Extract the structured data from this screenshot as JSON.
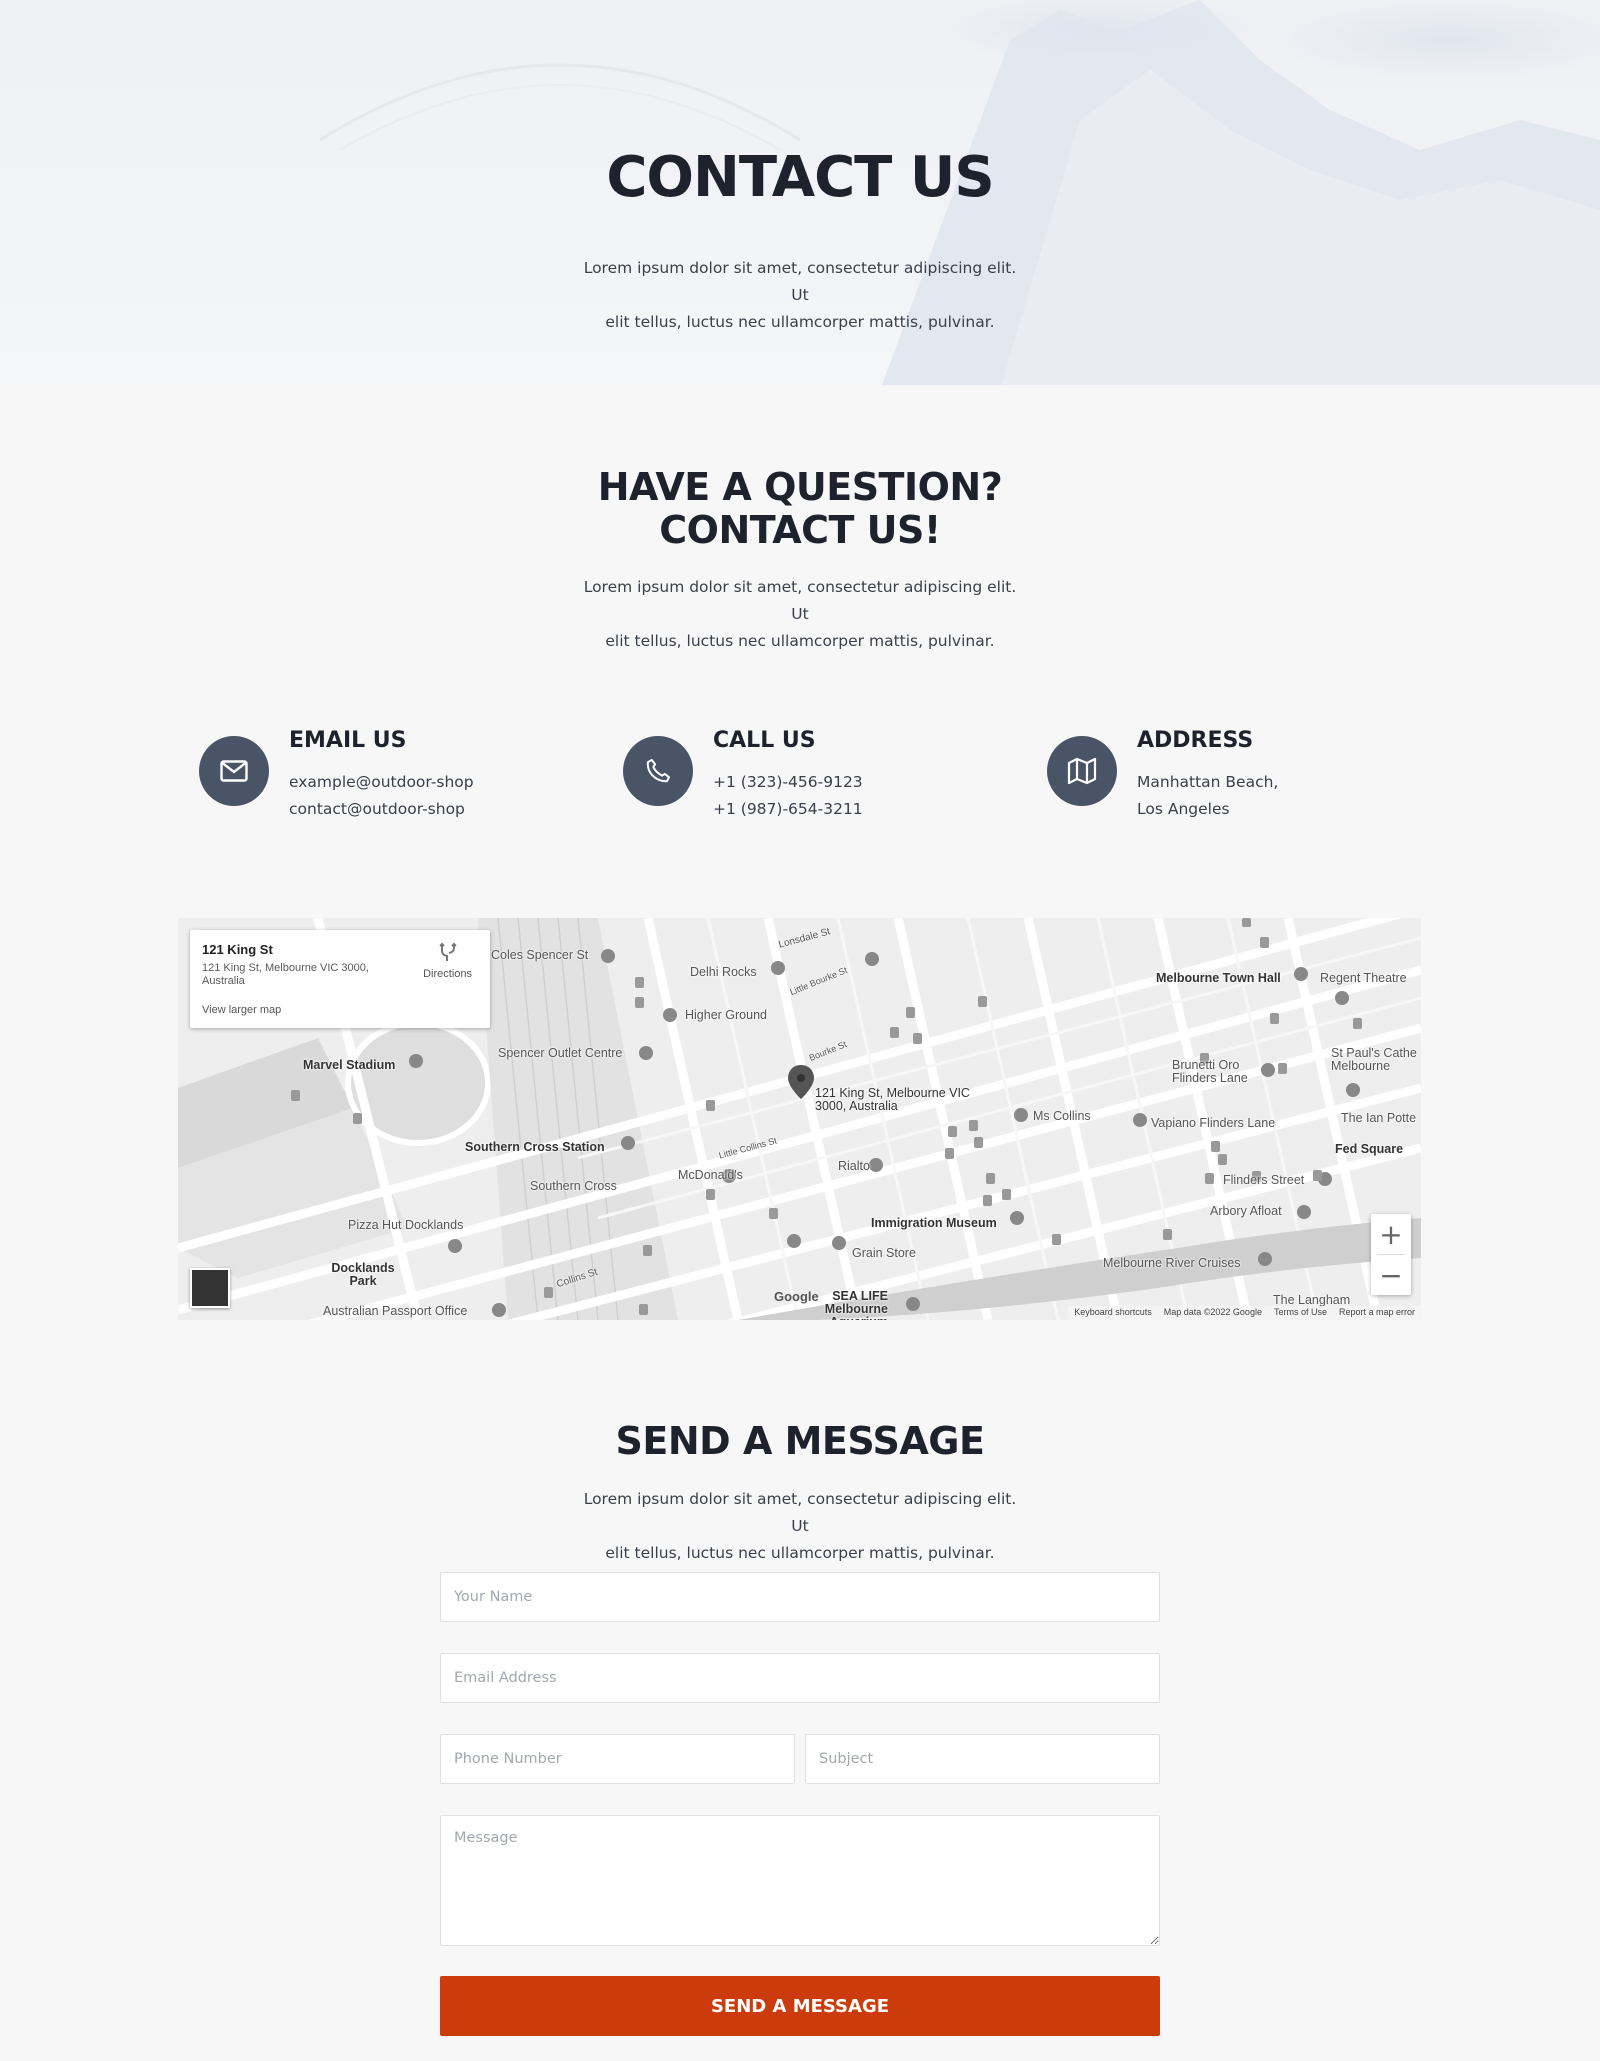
{
  "hero": {
    "title": "CONTACT US",
    "lead_line1": "Lorem ipsum dolor sit amet, consectetur adipiscing elit. Ut",
    "lead_line2": "elit tellus, luctus nec ullamcorper mattis, pulvinar."
  },
  "question": {
    "title_line1": "HAVE A QUESTION?",
    "title_line2": "CONTACT US!",
    "lead_line1": "Lorem ipsum dolor sit amet, consectetur adipiscing elit. Ut",
    "lead_line2": "elit tellus, luctus nec ullamcorper mattis, pulvinar."
  },
  "contacts": [
    {
      "title": "EMAIL US",
      "line1": "example@outdoor-shop",
      "line2": "contact@outdoor-shop",
      "icon": "envelope-icon"
    },
    {
      "title": "CALL US",
      "line1": "+1 (323)-456-9123",
      "line2": "+1 (987)-654-3211",
      "icon": "phone-icon"
    },
    {
      "title": "ADDRESS",
      "line1": "Manhattan Beach,",
      "line2": "Los Angeles",
      "icon": "map-icon"
    }
  ],
  "map": {
    "card_title": "121 King St",
    "card_address": "121 King St, Melbourne VIC 3000, Australia",
    "directions": "Directions",
    "view_larger": "View larger map",
    "pin_label": "121 King St, Melbourne VIC 3000, Australia",
    "zoom_in": "+",
    "zoom_out": "−",
    "google": "Google",
    "footer": [
      "Keyboard shortcuts",
      "Map data ©2022 Google",
      "Terms of Use",
      "Report a map error"
    ],
    "labels": [
      "Coles Spencer St",
      "Delhi Rocks",
      "Lonsdale St",
      "Little Bourke St",
      "Higher Ground",
      "Marvel Stadium",
      "Spencer Outlet Centre",
      "Bourke St",
      "Melbourne Town Hall",
      "Regent Theatre",
      "Brunetti Oro Flinders Lane",
      "St Paul's Cathe Melbourne",
      "Ms Collins",
      "Vapiano Flinders Lane",
      "The Ian Potte",
      "Fed Square",
      "Southern Cross Station",
      "Little Collins St",
      "McDonald's",
      "Rialto",
      "Southern Cross",
      "Flinders Street",
      "Arbory Afloat",
      "Pizza Hut Docklands",
      "Immigration Museum",
      "Docklands Park",
      "Grain Store",
      "Melbourne River Cruises",
      "Collins St",
      "Australian Passport Office",
      "SEA LIFE Melbourne Aquarium",
      "The Langham"
    ]
  },
  "message": {
    "title": "SEND A MESSAGE",
    "lead_line1": "Lorem ipsum dolor sit amet, consectetur adipiscing elit. Ut",
    "lead_line2": "elit tellus, luctus nec ullamcorper mattis, pulvinar.",
    "name_placeholder": "Your Name",
    "email_placeholder": "Email Address",
    "phone_placeholder": "Phone Number",
    "subject_placeholder": "Subject",
    "message_placeholder": "Message",
    "submit": "SEND A MESSAGE"
  },
  "colors": {
    "accent": "#cc3b0b",
    "icon_circle": "#4a5467",
    "heading": "#1d222c"
  }
}
